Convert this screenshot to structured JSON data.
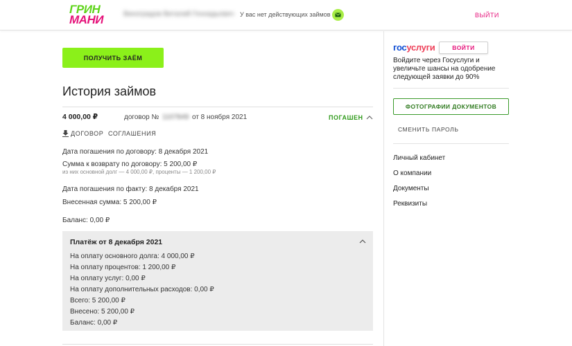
{
  "header": {
    "logo_line1": "ГРИН",
    "logo_line2": "МАНИ",
    "username": "Виноградов Виталий Геннадьевич",
    "no_loans_text": "У вас нет действующих займов",
    "mail_icon": "mail-icon",
    "logout_label": "ВЫЙТИ"
  },
  "main": {
    "get_loan_label": "ПОЛУЧИТЬ ЗАЁМ",
    "title": "История займов",
    "loan": {
      "amount": "4 000,00 ₽",
      "contract_prefix": "договор №",
      "contract_number": "1107849",
      "contract_date": "от 8 ноября 2021",
      "status": "ПОГАШЕН",
      "doc_label": "ДОГОВОР",
      "agreements_label": "СОГЛАШЕНИЯ",
      "due_date": "Дата погашения по договору: 8 декабря 2021",
      "return_sum": "Сумма к возврату по договору: 5 200,00 ₽",
      "return_breakdown": "из них основной долг — 4 000,00 ₽, проценты — 1 200,00 ₽",
      "actual_date": "Дата погашения по факту: 8 декабря 2021",
      "paid_sum": "Внесенная сумма: 5 200,00 ₽",
      "balance": "Баланс: 0,00 ₽"
    },
    "payment": {
      "title": "Платёж от 8 декабря 2021",
      "lines": [
        "На оплату основного долга: 4 000,00 ₽",
        "На оплату процентов: 1 200,00 ₽",
        "На оплату услуг: 0,00 ₽",
        "На оплату дополнительных расходов: 0,00 ₽",
        "Всего: 5 200,00 ₽",
        "Внесено: 5 200,00 ₽",
        "Баланс: 0,00 ₽"
      ]
    }
  },
  "sidebar": {
    "gos_part1": "гос",
    "gos_part2": "услуги",
    "gos_login_label": "ВОЙТИ",
    "gos_text": "Войдите через Госуслуги и увеличьте шансы на одобрение следующей заявки до 90%",
    "photos_label": "ФОТОГРАФИИ ДОКУМЕНТОВ",
    "change_password_label": "СМЕНИТЬ ПАРОЛЬ",
    "links": [
      "Личный кабинет",
      "О компании",
      "Документы",
      "Реквизиты"
    ]
  },
  "colors": {
    "brand_green": "#8bf01a",
    "brand_pink": "#e5127a",
    "status_green": "#2f9a1a"
  }
}
